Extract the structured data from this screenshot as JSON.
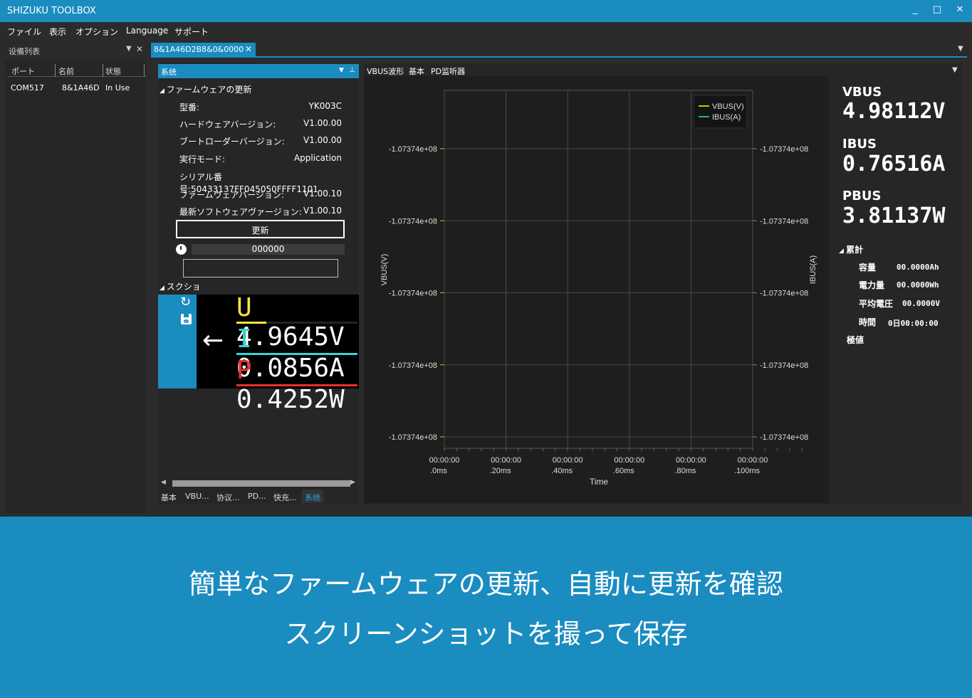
{
  "window": {
    "title": "SHIZUKU TOOLBOX",
    "min": "_",
    "max": "□",
    "close": "✕"
  },
  "menu": [
    "ファイル",
    "表示",
    "オプション",
    "Language",
    "サポート"
  ],
  "device_list": {
    "tab": "设備列表",
    "cols": [
      "ポート",
      "名前",
      "状態"
    ],
    "row": [
      "COM517",
      "8&1A46D",
      "In Use"
    ]
  },
  "doc_tab": {
    "label": "8&1A46D2B8&0&0000",
    "close": "✕"
  },
  "system": {
    "header": "系统",
    "firmware_section": "ファームウェアの更新",
    "fields": [
      {
        "k": "型番:",
        "v": "YK003C"
      },
      {
        "k": "ハードウェアバージョン:",
        "v": "V1.00.00"
      },
      {
        "k": "ブートローダーバージョン:",
        "v": "V1.00.00"
      },
      {
        "k": "実行モード:",
        "v": "Application"
      },
      {
        "k": "シリアル番号:50433137FF045050FFFF1101",
        "v": ""
      },
      {
        "k": "ファームウェアバージョン:",
        "v": "V1.00.10"
      },
      {
        "k": "最新ソフトウェアヴァージョン:",
        "v": "V1.00.10"
      }
    ],
    "update_button": "更新",
    "progress": "000000",
    "input_value": "",
    "screenshot_section": "スクショ",
    "lcd": [
      {
        "k": "U",
        "v": "4.9645V",
        "color": "#ffe24a"
      },
      {
        "k": "I",
        "v": "0.0856A",
        "color": "#34d6d6"
      },
      {
        "k": "P",
        "v": "0.4252W",
        "color": "#e83030"
      }
    ],
    "bottom_tabs": [
      "基本",
      "VBU...",
      "协议...",
      "PD...",
      "快充...",
      "系统"
    ]
  },
  "right_tabs": [
    "VBUS波形",
    "基本",
    "PD监听器"
  ],
  "readings": {
    "vbus_label": "VBUS",
    "vbus": "4.98112V",
    "ibus_label": "IBUS",
    "ibus": "0.76516A",
    "pbus_label": "PBUS",
    "pbus": "3.81137W"
  },
  "accum": {
    "title": "累計",
    "rows": [
      {
        "k": "容量",
        "v": "00.0000Ah"
      },
      {
        "k": "電力量",
        "v": "00.0000Wh"
      },
      {
        "k": "平均電圧",
        "v": "00.0000V"
      },
      {
        "k": "時間",
        "v": "0日00:00:00"
      }
    ],
    "extreme": "極値"
  },
  "chart_data": {
    "type": "line",
    "xlabel": "Time",
    "ylabel_left": "VBUS(V)",
    "ylabel_right": "IBUS(A)",
    "x_ticks": [
      [
        "00:00:00",
        ".0ms"
      ],
      [
        "00:00:00",
        ".20ms"
      ],
      [
        "00:00:00",
        ".40ms"
      ],
      [
        "00:00:00",
        ".60ms"
      ],
      [
        "00:00:00",
        ".80ms"
      ],
      [
        "00:00:00",
        ".100ms"
      ]
    ],
    "y_ticks_left": [
      "-1.07374e+08",
      "-1.07374e+08",
      "-1.07374e+08",
      "-1.07374e+08",
      "-1.07374e+08"
    ],
    "y_ticks_right": [
      "-1.07374e+08",
      "-1.07374e+08",
      "-1.07374e+08",
      "-1.07374e+08",
      "-1.07374e+08"
    ],
    "series": [
      {
        "name": "VBUS(V)",
        "color": "#c8c800",
        "values": []
      },
      {
        "name": "IBUS(A)",
        "color": "#20b0b0",
        "values": []
      }
    ],
    "legend": "top-right",
    "grid": true
  },
  "banner": {
    "line1": "簡単なファームウェアの更新、自動に更新を確認",
    "line2": "スクリーンショットを撮って保存"
  }
}
